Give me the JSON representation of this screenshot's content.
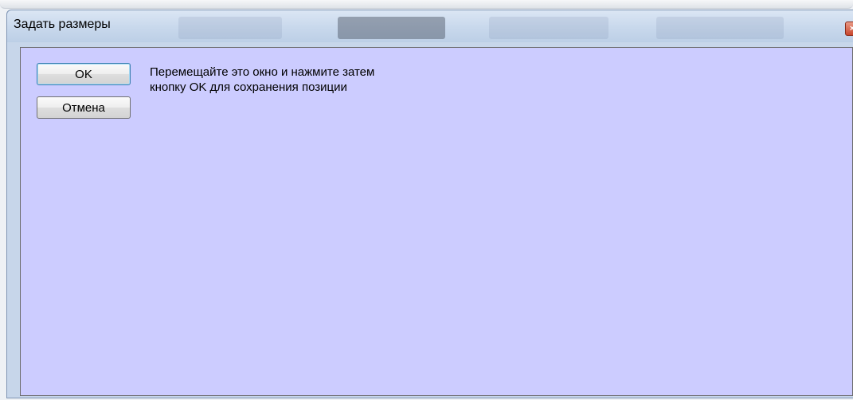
{
  "window": {
    "title": "Задать размеры",
    "close_icon": "×"
  },
  "buttons": {
    "ok_label": "OK",
    "cancel_label": "Отмена"
  },
  "message": {
    "line1": "Перемещайте это окно и нажмите затем",
    "line2": "кнопку OK для сохранения позиции"
  },
  "colors": {
    "client_background": "#ccccff",
    "close_button": "#c8452c"
  }
}
